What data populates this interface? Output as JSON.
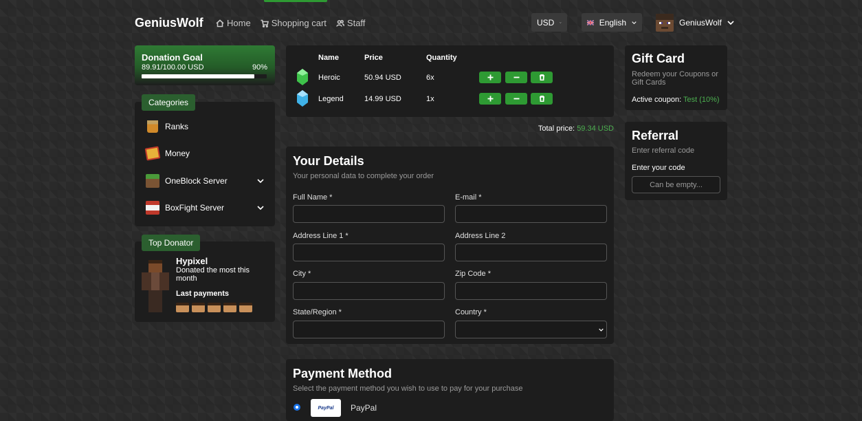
{
  "header": {
    "brand": "GeniusWolf",
    "nav": [
      {
        "label": "Home",
        "icon": "home-icon"
      },
      {
        "label": "Shopping cart",
        "icon": "cart-icon"
      },
      {
        "label": "Staff",
        "icon": "users-icon"
      }
    ],
    "currency": "USD",
    "language": "English",
    "username": "GeniusWolf"
  },
  "donation_goal": {
    "title": "Donation Goal",
    "amount": "89.91/100.00 USD",
    "percent_label": "90%",
    "progress": 0.9
  },
  "categories": {
    "title": "Categories",
    "items": [
      {
        "label": "Ranks",
        "icon": "bucket-icon",
        "expandable": false
      },
      {
        "label": "Money",
        "icon": "money-icon",
        "expandable": false
      },
      {
        "label": "OneBlock Server",
        "icon": "grass-block-icon",
        "expandable": true
      },
      {
        "label": "BoxFight Server",
        "icon": "tnt-icon",
        "expandable": true
      }
    ]
  },
  "top_donator": {
    "title": "Top Donator",
    "name": "Hypixel",
    "description": "Donated the most this month",
    "last_payments_title": "Last payments"
  },
  "cart": {
    "headers": {
      "name": "Name",
      "price": "Price",
      "quantity": "Quantity"
    },
    "items": [
      {
        "name": "Heroic",
        "price": "50.94 USD",
        "quantity": "6x",
        "color": "#3ec24a"
      },
      {
        "name": "Legend",
        "price": "14.99 USD",
        "quantity": "1x",
        "color": "#3fb2e8"
      }
    ],
    "total_label": "Total price:",
    "total_value": "59.34 USD"
  },
  "details": {
    "title": "Your Details",
    "subtitle": "Your personal data to complete your order",
    "fields": {
      "full_name": "Full Name *",
      "email": "E-mail *",
      "address1": "Address Line 1 *",
      "address2": "Address Line 2",
      "city": "City *",
      "zip": "Zip Code *",
      "state": "State/Region *",
      "country": "Country *"
    }
  },
  "payment": {
    "title": "Payment Method",
    "subtitle": "Select the payment method you wish to use to pay for your purchase",
    "option_label": "PayPal",
    "logo_text": "PayPal"
  },
  "gift_card": {
    "title": "Gift Card",
    "subtitle": "Redeem your Coupons or Gift Cards",
    "active_label": "Active coupon:",
    "active_value": "Test (10%)"
  },
  "referral": {
    "title": "Referral",
    "subtitle": "Enter referral code",
    "label": "Enter your code",
    "placeholder": "Can be empty..."
  }
}
